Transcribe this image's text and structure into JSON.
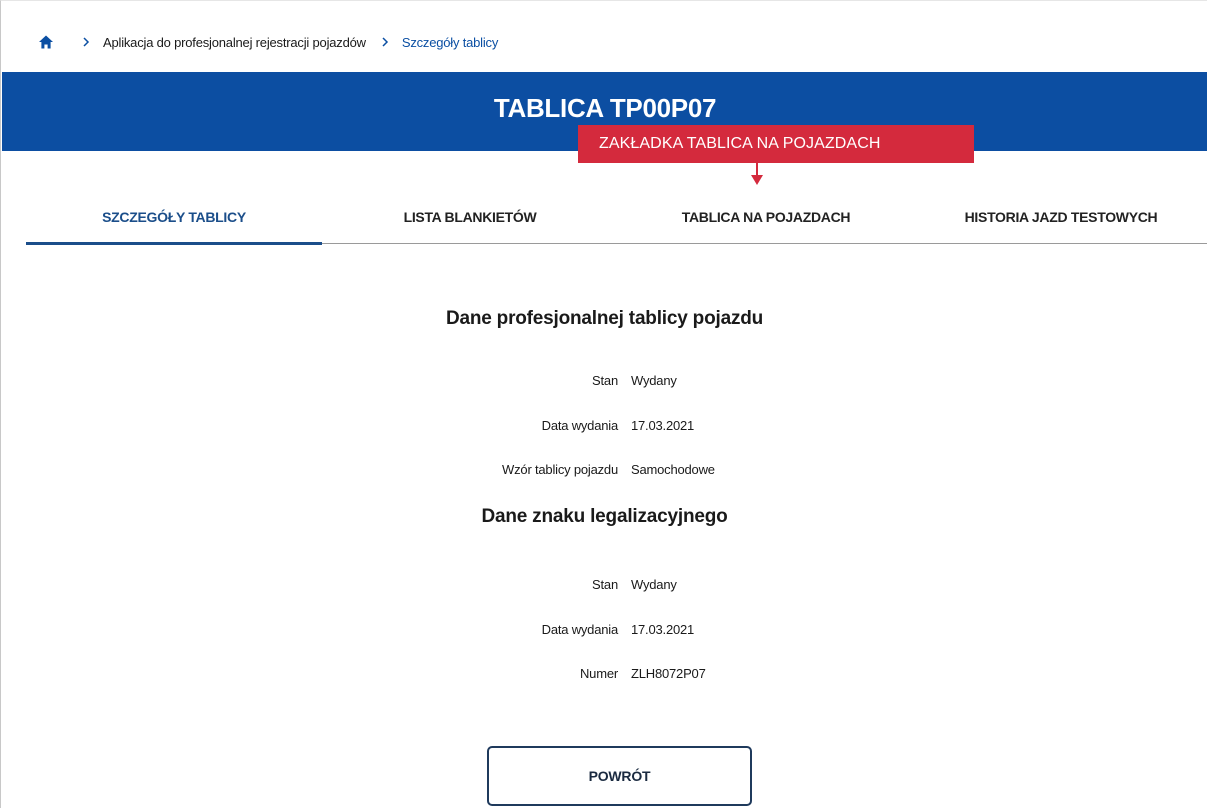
{
  "breadcrumb": {
    "home_icon": "home-icon",
    "items": [
      "Aplikacja do profesjonalnej rejestracji pojazdów",
      "Szczegóły tablicy"
    ]
  },
  "header": {
    "title": "TABLICA TP00P07",
    "color": "#0c4ea2"
  },
  "annotation": {
    "label": "ZAKŁADKA TABLICA NA POJAZDACH",
    "color": "#d42a3d"
  },
  "tabs": [
    {
      "label": "SZCZEGÓŁY TABLICY",
      "active": true
    },
    {
      "label": "LISTA BLANKIETÓW",
      "active": false
    },
    {
      "label": "TABLICA NA POJAZDACH",
      "active": false
    },
    {
      "label": "HISTORIA JAZD TESTOWYCH",
      "active": false
    }
  ],
  "plate_section": {
    "title": "Dane profesjonalnej tablicy pojazdu",
    "rows": [
      {
        "label": "Stan",
        "value": "Wydany"
      },
      {
        "label": "Data wydania",
        "value": "17.03.2021"
      },
      {
        "label": "Wzór tablicy pojazdu",
        "value": "Samochodowe"
      }
    ]
  },
  "sign_section": {
    "title": "Dane znaku legalizacyjnego",
    "rows": [
      {
        "label": "Stan",
        "value": "Wydany"
      },
      {
        "label": "Data wydania",
        "value": "17.03.2021"
      },
      {
        "label": "Numer",
        "value": "ZLH8072P07"
      }
    ]
  },
  "actions": {
    "back_label": "POWRÓT"
  }
}
